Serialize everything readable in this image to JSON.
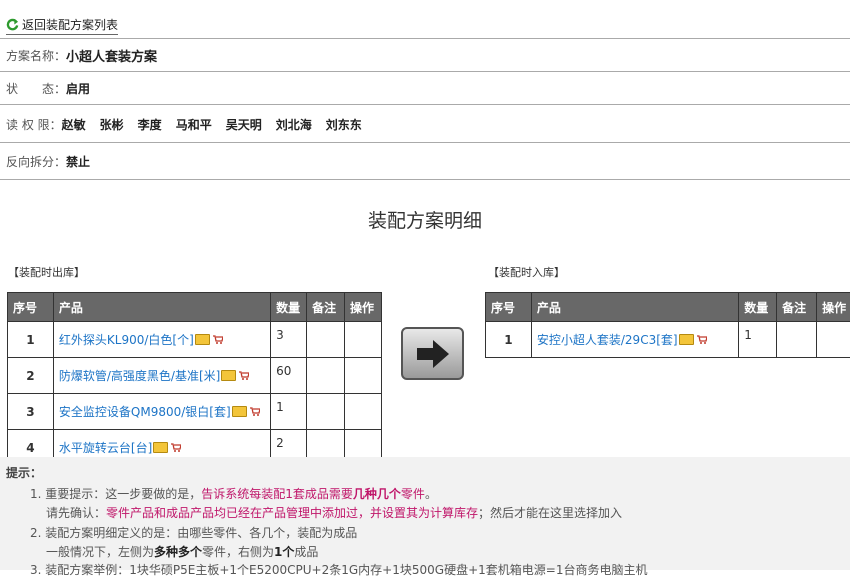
{
  "back_link": "返回装配方案列表",
  "info": {
    "name_label": "方案名称：",
    "name_value": "小超人套装方案",
    "status_label": "状　　态：",
    "status_value": "启用",
    "readers_label": "读 权 限：",
    "readers": [
      "赵敏",
      "张彬",
      "李度",
      "马和平",
      "吴天明",
      "刘北海",
      "刘东东"
    ],
    "reverse_label": "反向拆分：",
    "reverse_value": "禁止"
  },
  "detail_title": "装配方案明细",
  "out_table": {
    "caption": "【装配时出库】",
    "headers": [
      "序号",
      "产品",
      "数量",
      "备注",
      "操作"
    ],
    "rows": [
      {
        "no": "1",
        "product": "红外探头KL900/白色[个]",
        "qty": "3"
      },
      {
        "no": "2",
        "product": "防爆软管/高强度黑色/基准[米]",
        "qty": "60"
      },
      {
        "no": "3",
        "product": "安全监控设备QM9800/银白[套]",
        "qty": "1"
      },
      {
        "no": "4",
        "product": "水平旋转云台[台]",
        "qty": "2"
      }
    ]
  },
  "in_table": {
    "caption": "【装配时入库】",
    "headers": [
      "序号",
      "产品",
      "数量",
      "备注",
      "操作"
    ],
    "rows": [
      {
        "no": "1",
        "product": "安控小超人套装/29C3[套]",
        "qty": "1"
      }
    ]
  },
  "tips": {
    "heading": "提示：",
    "l1_a": "1.  重要提示：这一步要做的是，",
    "l1_b": "告诉系统每装配1套成品需要",
    "l1_c": "几种几个",
    "l1_d": "零件",
    "l1_e": "。",
    "l2_a": "请先确认：",
    "l2_b": "零件产品和成品产品均已经在产品管理中添加过，并设置其为计算库存",
    "l2_c": "；然后才能在这里选择加入",
    "l3": "2.  装配方案明细定义的是：由哪些零件、各几个，装配为成品",
    "l4_a": "一般情况下，左侧为",
    "l4_b": "多种多个",
    "l4_c": "零件，右侧为",
    "l4_d": "1个",
    "l4_e": "成品",
    "l5": "3.  装配方案举例：1块华硕P5E主板+1个E5200CPU+2条1G内存+1块500G硬盘+1套机箱电源=1台商务电脑主机"
  }
}
